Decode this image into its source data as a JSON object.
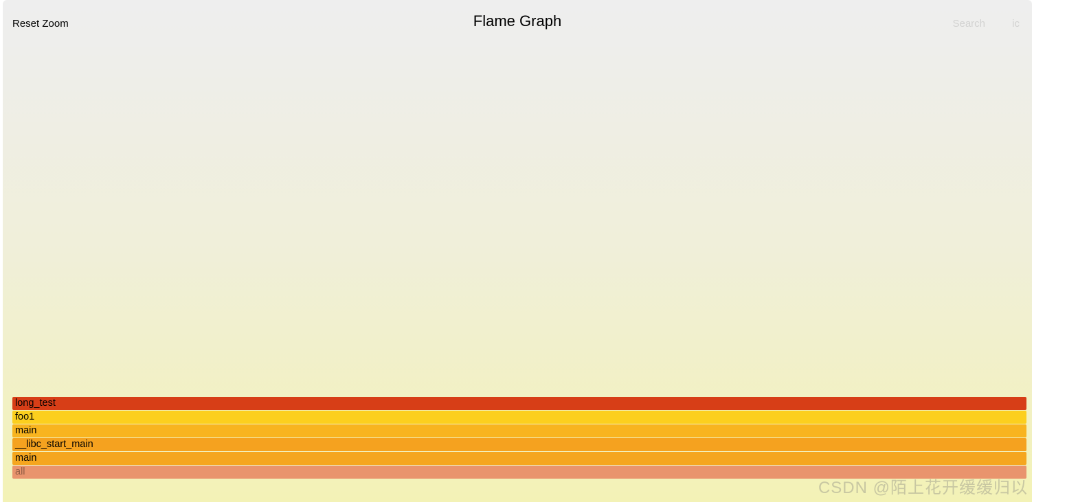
{
  "title": "Flame Graph",
  "controls": {
    "reset_zoom": "Reset Zoom",
    "search": "Search",
    "ic": "ic"
  },
  "chart_data": {
    "type": "bar",
    "orientation": "flamegraph",
    "frames": [
      {
        "name": "all",
        "depth": 0,
        "width_pct": 100,
        "color": "#e9946d"
      },
      {
        "name": "main",
        "depth": 1,
        "width_pct": 100,
        "color": "#f5a61f"
      },
      {
        "name": "__libc_start_main",
        "depth": 2,
        "width_pct": 100,
        "color": "#f5a21f"
      },
      {
        "name": "main",
        "depth": 3,
        "width_pct": 100,
        "color": "#f8b41f"
      },
      {
        "name": "foo1",
        "depth": 4,
        "width_pct": 100,
        "color": "#fccf1e"
      },
      {
        "name": "long_test",
        "depth": 5,
        "width_pct": 100,
        "color": "#d73e17"
      }
    ]
  },
  "watermark": "CSDN @陌上花开缓缓归以"
}
